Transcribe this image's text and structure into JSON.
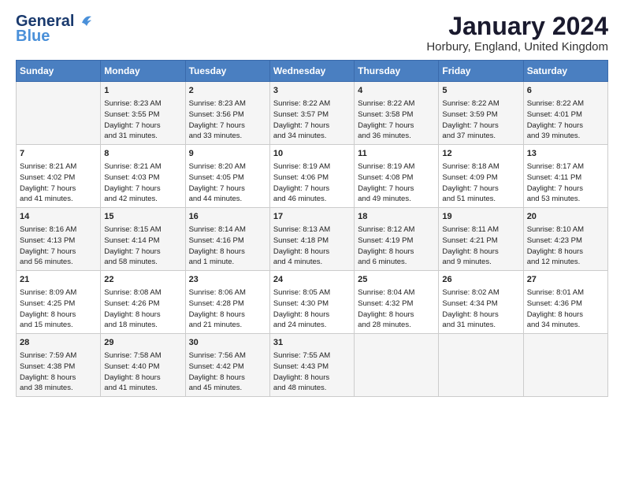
{
  "header": {
    "logo_line1": "General",
    "logo_line2": "Blue",
    "month": "January 2024",
    "location": "Horbury, England, United Kingdom"
  },
  "days_of_week": [
    "Sunday",
    "Monday",
    "Tuesday",
    "Wednesday",
    "Thursday",
    "Friday",
    "Saturday"
  ],
  "weeks": [
    [
      {
        "day": "",
        "content": ""
      },
      {
        "day": "1",
        "content": "Sunrise: 8:23 AM\nSunset: 3:55 PM\nDaylight: 7 hours\nand 31 minutes."
      },
      {
        "day": "2",
        "content": "Sunrise: 8:23 AM\nSunset: 3:56 PM\nDaylight: 7 hours\nand 33 minutes."
      },
      {
        "day": "3",
        "content": "Sunrise: 8:22 AM\nSunset: 3:57 PM\nDaylight: 7 hours\nand 34 minutes."
      },
      {
        "day": "4",
        "content": "Sunrise: 8:22 AM\nSunset: 3:58 PM\nDaylight: 7 hours\nand 36 minutes."
      },
      {
        "day": "5",
        "content": "Sunrise: 8:22 AM\nSunset: 3:59 PM\nDaylight: 7 hours\nand 37 minutes."
      },
      {
        "day": "6",
        "content": "Sunrise: 8:22 AM\nSunset: 4:01 PM\nDaylight: 7 hours\nand 39 minutes."
      }
    ],
    [
      {
        "day": "7",
        "content": "Sunrise: 8:21 AM\nSunset: 4:02 PM\nDaylight: 7 hours\nand 41 minutes."
      },
      {
        "day": "8",
        "content": "Sunrise: 8:21 AM\nSunset: 4:03 PM\nDaylight: 7 hours\nand 42 minutes."
      },
      {
        "day": "9",
        "content": "Sunrise: 8:20 AM\nSunset: 4:05 PM\nDaylight: 7 hours\nand 44 minutes."
      },
      {
        "day": "10",
        "content": "Sunrise: 8:19 AM\nSunset: 4:06 PM\nDaylight: 7 hours\nand 46 minutes."
      },
      {
        "day": "11",
        "content": "Sunrise: 8:19 AM\nSunset: 4:08 PM\nDaylight: 7 hours\nand 49 minutes."
      },
      {
        "day": "12",
        "content": "Sunrise: 8:18 AM\nSunset: 4:09 PM\nDaylight: 7 hours\nand 51 minutes."
      },
      {
        "day": "13",
        "content": "Sunrise: 8:17 AM\nSunset: 4:11 PM\nDaylight: 7 hours\nand 53 minutes."
      }
    ],
    [
      {
        "day": "14",
        "content": "Sunrise: 8:16 AM\nSunset: 4:13 PM\nDaylight: 7 hours\nand 56 minutes."
      },
      {
        "day": "15",
        "content": "Sunrise: 8:15 AM\nSunset: 4:14 PM\nDaylight: 7 hours\nand 58 minutes."
      },
      {
        "day": "16",
        "content": "Sunrise: 8:14 AM\nSunset: 4:16 PM\nDaylight: 8 hours\nand 1 minute."
      },
      {
        "day": "17",
        "content": "Sunrise: 8:13 AM\nSunset: 4:18 PM\nDaylight: 8 hours\nand 4 minutes."
      },
      {
        "day": "18",
        "content": "Sunrise: 8:12 AM\nSunset: 4:19 PM\nDaylight: 8 hours\nand 6 minutes."
      },
      {
        "day": "19",
        "content": "Sunrise: 8:11 AM\nSunset: 4:21 PM\nDaylight: 8 hours\nand 9 minutes."
      },
      {
        "day": "20",
        "content": "Sunrise: 8:10 AM\nSunset: 4:23 PM\nDaylight: 8 hours\nand 12 minutes."
      }
    ],
    [
      {
        "day": "21",
        "content": "Sunrise: 8:09 AM\nSunset: 4:25 PM\nDaylight: 8 hours\nand 15 minutes."
      },
      {
        "day": "22",
        "content": "Sunrise: 8:08 AM\nSunset: 4:26 PM\nDaylight: 8 hours\nand 18 minutes."
      },
      {
        "day": "23",
        "content": "Sunrise: 8:06 AM\nSunset: 4:28 PM\nDaylight: 8 hours\nand 21 minutes."
      },
      {
        "day": "24",
        "content": "Sunrise: 8:05 AM\nSunset: 4:30 PM\nDaylight: 8 hours\nand 24 minutes."
      },
      {
        "day": "25",
        "content": "Sunrise: 8:04 AM\nSunset: 4:32 PM\nDaylight: 8 hours\nand 28 minutes."
      },
      {
        "day": "26",
        "content": "Sunrise: 8:02 AM\nSunset: 4:34 PM\nDaylight: 8 hours\nand 31 minutes."
      },
      {
        "day": "27",
        "content": "Sunrise: 8:01 AM\nSunset: 4:36 PM\nDaylight: 8 hours\nand 34 minutes."
      }
    ],
    [
      {
        "day": "28",
        "content": "Sunrise: 7:59 AM\nSunset: 4:38 PM\nDaylight: 8 hours\nand 38 minutes."
      },
      {
        "day": "29",
        "content": "Sunrise: 7:58 AM\nSunset: 4:40 PM\nDaylight: 8 hours\nand 41 minutes."
      },
      {
        "day": "30",
        "content": "Sunrise: 7:56 AM\nSunset: 4:42 PM\nDaylight: 8 hours\nand 45 minutes."
      },
      {
        "day": "31",
        "content": "Sunrise: 7:55 AM\nSunset: 4:43 PM\nDaylight: 8 hours\nand 48 minutes."
      },
      {
        "day": "",
        "content": ""
      },
      {
        "day": "",
        "content": ""
      },
      {
        "day": "",
        "content": ""
      }
    ]
  ]
}
